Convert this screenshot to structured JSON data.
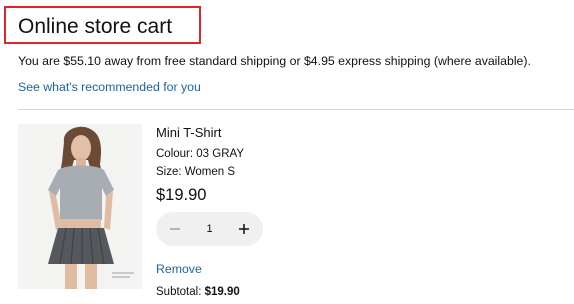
{
  "header": {
    "title": "Online store cart"
  },
  "shipping": {
    "message": "You are $55.10 away from free standard shipping or $4.95 express shipping (where available)."
  },
  "recommendations": {
    "link_label": "See what's recommended for you"
  },
  "cart": {
    "items": [
      {
        "name": "Mini T-Shirt",
        "colour": "Colour: 03 GRAY",
        "size": "Size: Women S",
        "price": "$19.90",
        "quantity": "1",
        "remove_label": "Remove",
        "subtotal_label": "Subtotal: ",
        "subtotal_value": "$19.90",
        "image_icon": "product-photo"
      }
    ]
  },
  "colors": {
    "highlight_border": "#e0242b",
    "link": "#1a63b0",
    "stepper_bg": "#f0f0f0"
  }
}
